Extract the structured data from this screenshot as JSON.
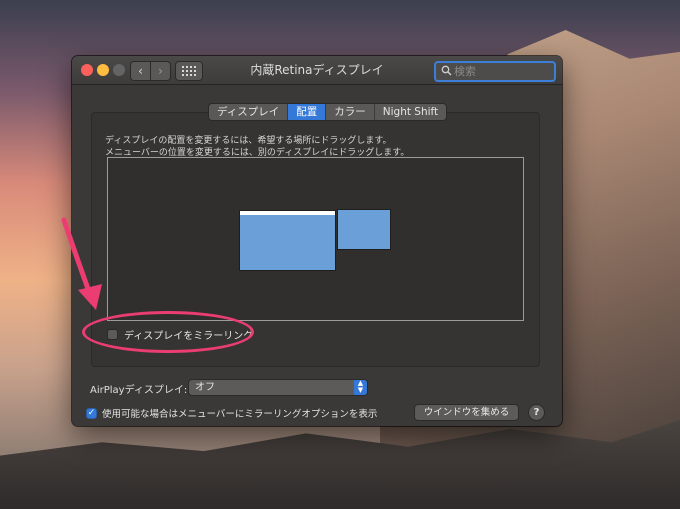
{
  "window": {
    "title": "内蔵Retinaディスプレイ",
    "search_placeholder": "検索"
  },
  "nav": {
    "back_glyph": "‹",
    "forward_glyph": "›"
  },
  "tabs": [
    {
      "label": "ディスプレイ",
      "active": false
    },
    {
      "label": "配置",
      "active": true
    },
    {
      "label": "カラー",
      "active": false
    },
    {
      "label": "Night Shift",
      "active": false
    }
  ],
  "arrangement": {
    "description_line1": "ディスプレイの配置を変更するには、希望する場所にドラッグします。",
    "description_line2": "メニューバーの位置を変更するには、別のディスプレイにドラッグします。",
    "mirror_label": "ディスプレイをミラーリング",
    "mirror_checked": false
  },
  "airplay": {
    "label": "AirPlayディスプレイ:",
    "value": "オフ"
  },
  "footer": {
    "menubar_mirroring_label": "使用可能な場合はメニューバーにミラーリングオプションを表示",
    "menubar_mirroring_checked": true,
    "gather_windows_label": "ウインドウを集める",
    "help_label": "?"
  },
  "colors": {
    "accent": "#3478d8",
    "annotation": "#ec3d72",
    "display_fill": "#6a9fd8"
  }
}
